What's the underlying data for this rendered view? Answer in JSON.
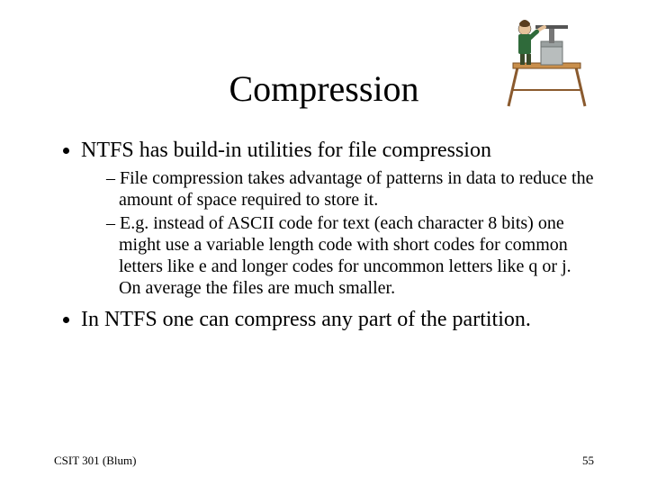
{
  "title": "Compression",
  "bullets": {
    "b1": "NTFS has build-in utilities for file compression",
    "b1_sub1": "File compression takes advantage of patterns in data to reduce the amount of space required to store it.",
    "b1_sub2": "E.g. instead of ASCII code for text (each character 8 bits) one might use a variable length code with short codes for common letters like e and longer codes for uncommon letters like q or j.  On average the files are much smaller.",
    "b2": "In NTFS one can compress any part of the partition."
  },
  "footer": {
    "left": "CSIT 301 (Blum)",
    "right": "55"
  }
}
